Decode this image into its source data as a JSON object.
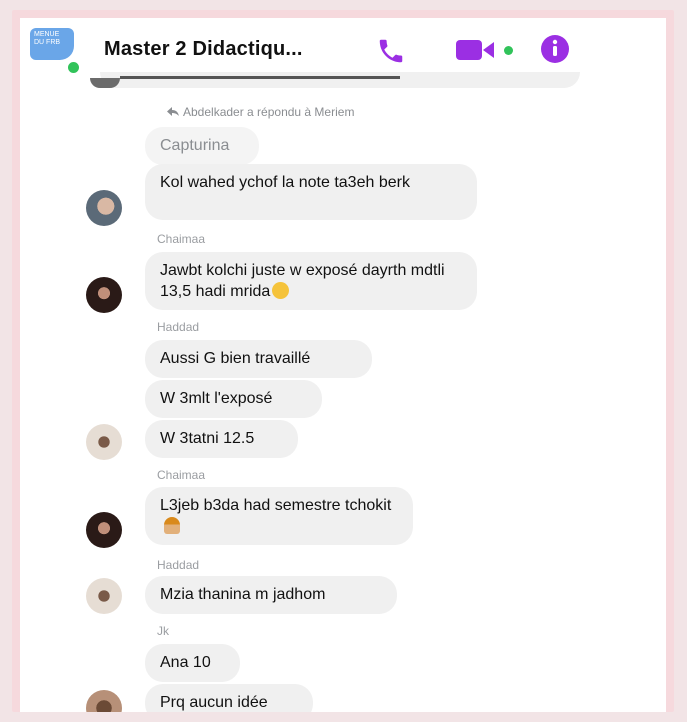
{
  "header": {
    "title": "Master 2 Didactiqu...",
    "group_avatar_text": "MENUE DU FRB",
    "icons": [
      "phone-icon",
      "video-camera-icon",
      "info-icon"
    ],
    "accent_color": "#9b2fe3",
    "online_color": "#31c35a"
  },
  "reply_note": "Abdelkader a répondu à Meriem",
  "messages": [
    {
      "quoted": "Capturina"
    },
    {
      "text": "Kol wahed ychof la note ta3eh berk"
    },
    {
      "sender": "Chaimaa",
      "text": "Jawbt kolchi juste w exposé dayrth mdtli 13,5 hadi mrida"
    },
    {
      "sender": "Haddad",
      "text": "Aussi G bien travaillé"
    },
    {
      "text": "W 3mlt l'exposé"
    },
    {
      "text": "W 3tatni 12.5"
    },
    {
      "sender": "Chaimaa",
      "text": "L3jeb b3da had semestre tchokit"
    },
    {
      "sender": "Haddad",
      "text": "Mzia thanina m jadhom"
    },
    {
      "sender": "Jk",
      "text": "Ana 10"
    },
    {
      "text": "Prq aucun idée"
    }
  ]
}
